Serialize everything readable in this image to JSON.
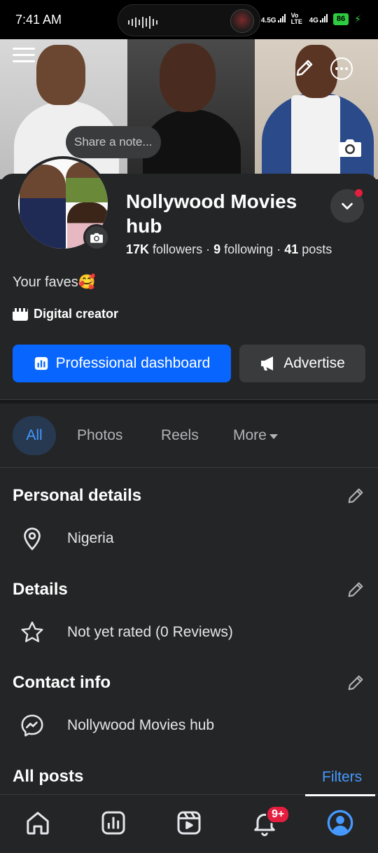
{
  "status_bar": {
    "time": "7:41 AM",
    "network_1": "4.5G",
    "volte": "Vo LTE",
    "network_2": "4G",
    "battery": "86"
  },
  "cover": {
    "share_note": "Share a note..."
  },
  "profile": {
    "name": "Nollywood Movies hub",
    "followers_count": "17K",
    "followers_label": "followers",
    "following_count": "9",
    "following_label": "following",
    "posts_count": "41",
    "posts_label": "posts",
    "separator": "·",
    "bio": "Your faves🥰",
    "category": "Digital creator"
  },
  "actions": {
    "dashboard_label": "Professional dashboard",
    "advertise_label": "Advertise"
  },
  "tabs": {
    "all": "All",
    "photos": "Photos",
    "reels": "Reels",
    "more": "More"
  },
  "personal_details": {
    "title": "Personal details",
    "location": "Nigeria"
  },
  "details": {
    "title": "Details",
    "rating": "Not yet rated (0 Reviews)"
  },
  "contact_info": {
    "title": "Contact info",
    "messenger": "Nollywood Movies hub"
  },
  "posts": {
    "title": "All posts",
    "filters_label": "Filters"
  },
  "bottom_nav": {
    "notifications_badge": "9+"
  },
  "colors": {
    "accent": "#0866ff",
    "link": "#4599ff",
    "background": "#242526",
    "badge": "#e41e3f"
  }
}
